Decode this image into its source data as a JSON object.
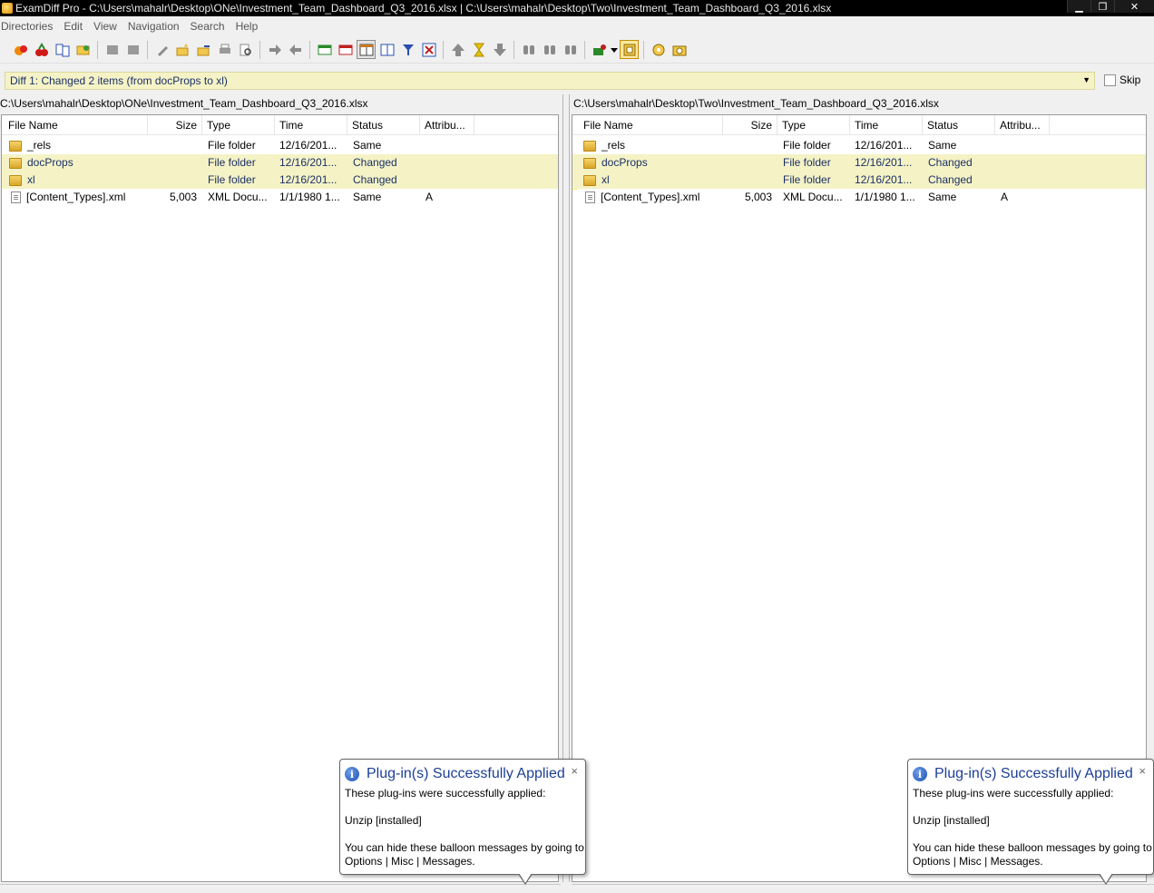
{
  "window": {
    "title": "ExamDiff Pro - C:\\Users\\mahalr\\Desktop\\ONe\\Investment_Team_Dashboard_Q3_2016.xlsx  |  C:\\Users\\mahalr\\Desktop\\Two\\Investment_Team_Dashboard_Q3_2016.xlsx",
    "minimize": "▁",
    "restore": "❐",
    "close": "✕"
  },
  "menu": [
    "Directories",
    "Edit",
    "View",
    "Navigation",
    "Search",
    "Help"
  ],
  "diffbar": {
    "text": "Diff 1: Changed 2 items (from docProps to xl)",
    "skip_label": "Skip"
  },
  "columns": {
    "name": "File Name",
    "size": "Size",
    "type": "Type",
    "time": "Time",
    "status": "Status",
    "attrib": "Attribu..."
  },
  "left": {
    "path": "C:\\Users\\mahalr\\Desktop\\ONe\\Investment_Team_Dashboard_Q3_2016.xlsx",
    "rows": [
      {
        "name": "_rels",
        "size": "",
        "type": "File folder",
        "time": "12/16/201...",
        "status": "Same",
        "attrib": ""
      },
      {
        "name": "docProps",
        "size": "",
        "type": "File folder",
        "time": "12/16/201...",
        "status": "Changed",
        "attrib": ""
      },
      {
        "name": "xl",
        "size": "",
        "type": "File folder",
        "time": "12/16/201...",
        "status": "Changed",
        "attrib": ""
      },
      {
        "name": "[Content_Types].xml",
        "size": "5,003",
        "type": "XML Docu...",
        "time": "1/1/1980 1...",
        "status": "Same",
        "attrib": "A"
      }
    ]
  },
  "right": {
    "path": "C:\\Users\\mahalr\\Desktop\\Two\\Investment_Team_Dashboard_Q3_2016.xlsx",
    "rows": [
      {
        "name": "_rels",
        "size": "",
        "type": "File folder",
        "time": "12/16/201...",
        "status": "Same",
        "attrib": ""
      },
      {
        "name": "docProps",
        "size": "",
        "type": "File folder",
        "time": "12/16/201...",
        "status": "Changed",
        "attrib": ""
      },
      {
        "name": "xl",
        "size": "",
        "type": "File folder",
        "time": "12/16/201...",
        "status": "Changed",
        "attrib": ""
      },
      {
        "name": "[Content_Types].xml",
        "size": "5,003",
        "type": "XML Docu...",
        "time": "1/1/1980 1...",
        "status": "Same",
        "attrib": "A"
      }
    ]
  },
  "balloon": {
    "title": "Plug-in(s) Successfully Applied",
    "line1": "These plug-ins were successfully applied:",
    "line2": "Unzip [installed]",
    "line3": "You can hide these balloon messages by going to",
    "line4": "Options | Misc | Messages.",
    "close": "×",
    "icon_glyph": "i"
  },
  "colors": {
    "changed_row": "#f5f3c6",
    "changed_text": "#1a2f66",
    "balloon_title": "#1c3f95"
  }
}
